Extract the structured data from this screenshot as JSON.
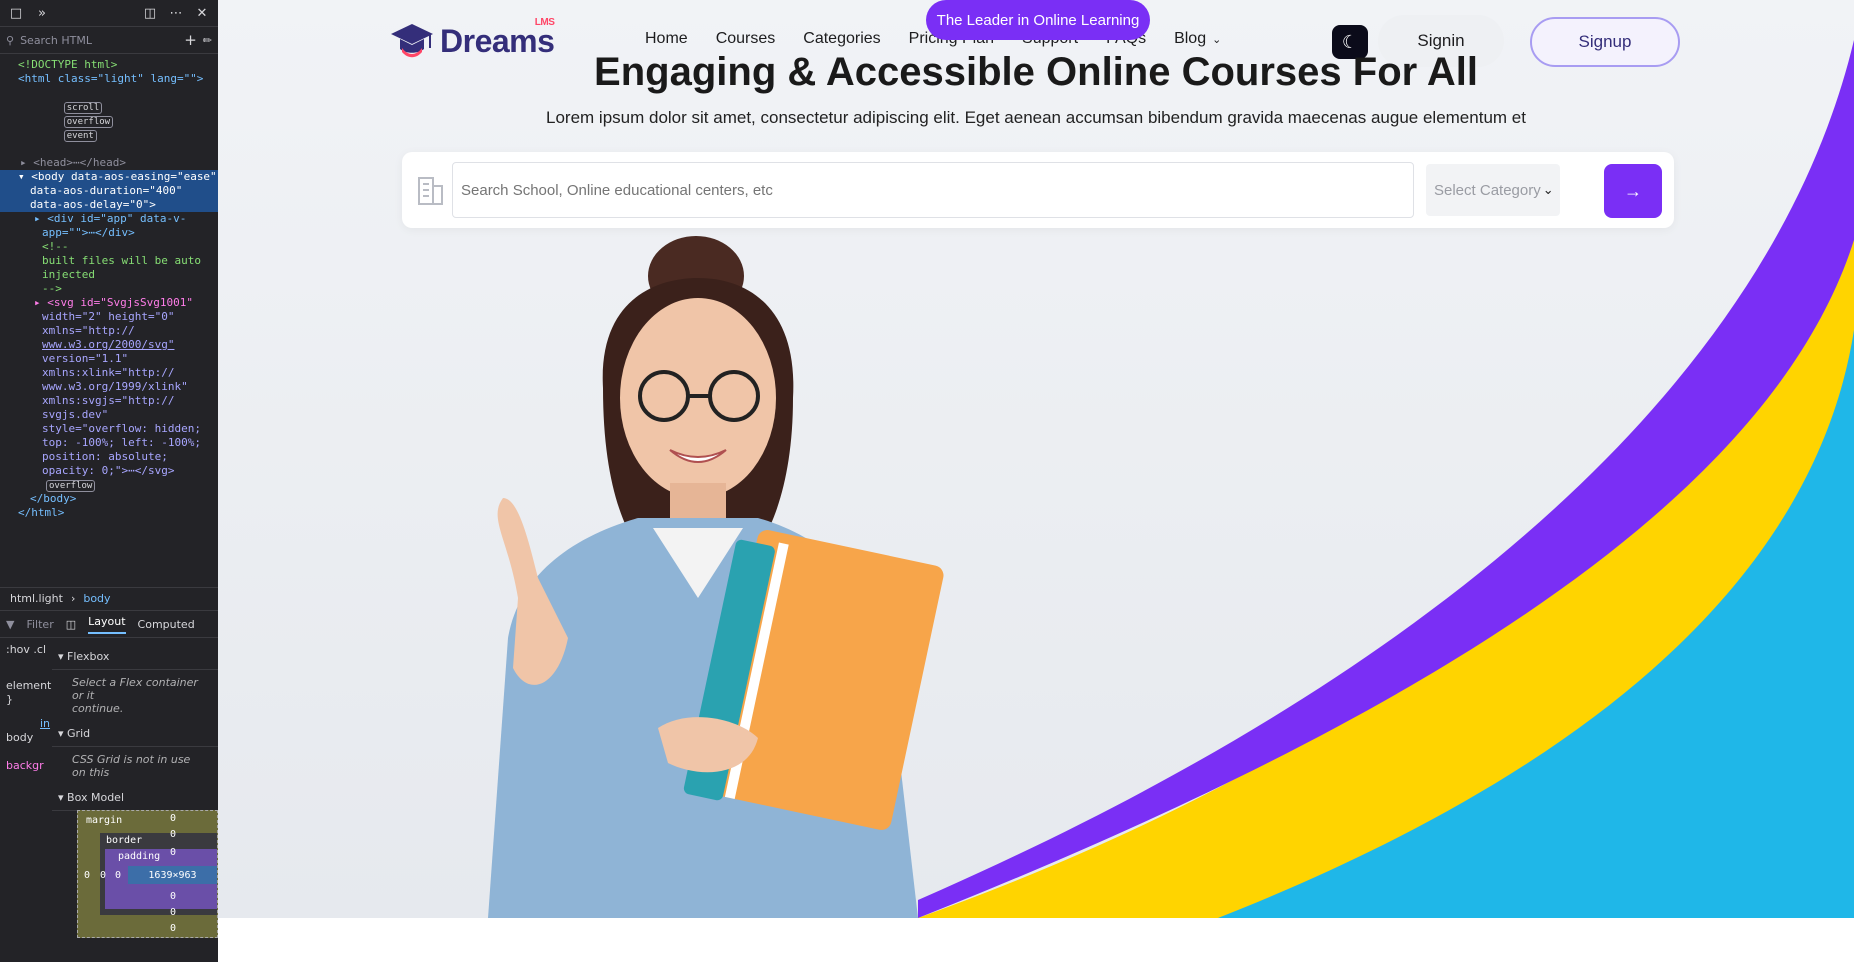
{
  "devtools": {
    "search_placeholder": "Search HTML",
    "tree": {
      "doctype": "<!DOCTYPE html>",
      "html_open": "<html class=\"light\" lang=\"\">",
      "badges_html": [
        "scroll",
        "overflow",
        "event"
      ],
      "head": "<head>⋯</head>",
      "body_open_1": "<body data-aos-easing=\"ease\"",
      "body_open_2": "data-aos-duration=\"400\"",
      "body_open_3": "data-aos-delay=\"0\">",
      "div_app_1": "<div id=\"app\" data-v-",
      "div_app_2": "app=\"\">⋯</div>",
      "comment_1": "<!--",
      "comment_2": "built files will be auto",
      "comment_3": "injected",
      "comment_4": "-->",
      "svg_lines": [
        "<svg id=\"SvgjsSvg1001\"",
        "width=\"2\" height=\"0\"",
        "xmlns=\"http://",
        "www.w3.org/2000/svg\"",
        "version=\"1.1\"",
        "xmlns:xlink=\"http://",
        "www.w3.org/1999/xlink\"",
        "xmlns:svgjs=\"http://",
        "svgjs.dev\"",
        "style=\"overflow: hidden;",
        "top: -100%; left: -100%;",
        "position: absolute;",
        "opacity: 0;\">⋯</svg>"
      ],
      "svg_badge": "overflow",
      "body_close": "</body>",
      "html_close": "</html>"
    },
    "breadcrumb": [
      "html.light",
      "body"
    ],
    "layout_tabs": [
      "Layout",
      "Computed"
    ],
    "filter_label": "Filter",
    "hov_label": ":hov",
    "cls_label": ".cl",
    "sections": {
      "flexbox": "Flexbox",
      "flexbox_note_1": "Select a Flex container or it",
      "flexbox_note_2": "continue.",
      "grid": "Grid",
      "grid_note": "CSS Grid is not in use on this",
      "boxmodel": "Box Model"
    },
    "left_gutter": [
      "element",
      "}",
      "in",
      "body",
      "backgr"
    ],
    "boxmodel": {
      "margin_label": "margin",
      "border_label": "border",
      "padding_label": "padding",
      "content_size": "1639×963",
      "zero": "0"
    }
  },
  "site": {
    "logo": {
      "text": "Dreams",
      "sup": "LMS"
    },
    "pill": "The Leader in Online Learning",
    "nav": [
      "Home",
      "Courses",
      "Categories",
      "Pricing Plan",
      "Support",
      "FAQs",
      "Blog"
    ],
    "signin": "Signin",
    "signup": "Signup",
    "headline": "Engaging & Accessible Online Courses For All",
    "subtitle": "Lorem ipsum dolor sit amet, consectetur adipiscing elit. Eget aenean accumsan bibendum gravida maecenas augue elementum et",
    "search": {
      "placeholder": "Search School, Online educational centers, etc",
      "category": "Select Category"
    },
    "colors": {
      "accent": "#7a2ff5",
      "yellow": "#ffd400",
      "cyan": "#1fb7e8",
      "brand": "#342e7a"
    }
  }
}
